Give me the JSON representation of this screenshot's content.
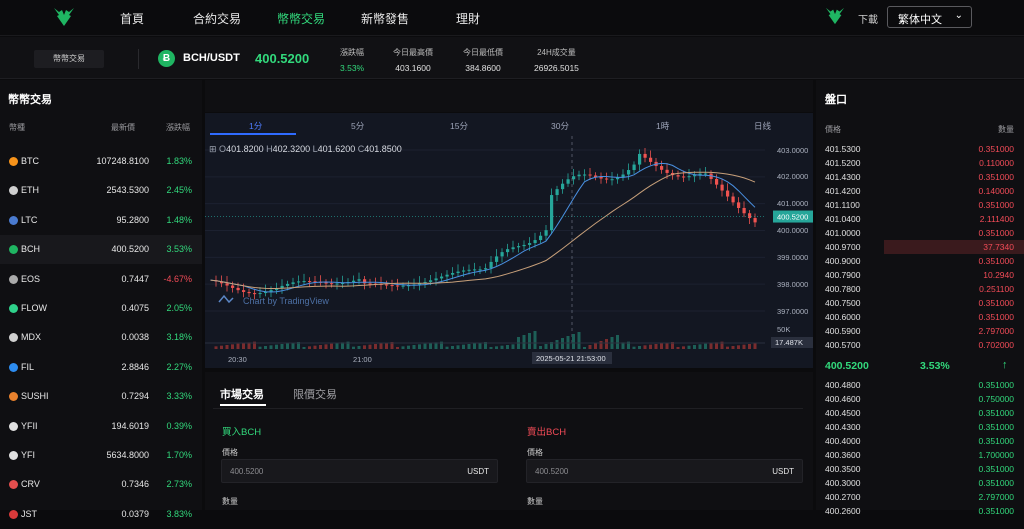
{
  "nav": {
    "items": [
      "首頁",
      "合約交易",
      "幣幣交易",
      "新幣發售",
      "理財"
    ],
    "download": "下載",
    "language": "繁体中文"
  },
  "ticker": {
    "button": "幣幣交易",
    "pair": "BCH/USDT",
    "price": "400.5200",
    "stats": [
      {
        "label": "漲跌幅",
        "value": "3.53%"
      },
      {
        "label": "今日最高價",
        "value": "403.1600"
      },
      {
        "label": "今日最低價",
        "value": "384.8600"
      },
      {
        "label": "24H成交量",
        "value": "26926.5015"
      }
    ]
  },
  "market": {
    "title": "幣幣交易",
    "headers": [
      "幣種",
      "最新價",
      "漲跌幅"
    ],
    "rows": [
      {
        "sym": "BTC",
        "price": "107248.8100",
        "change": "1.83%",
        "dir": "up",
        "color": "#f7931a"
      },
      {
        "sym": "ETH",
        "price": "2543.5300",
        "change": "2.45%",
        "dir": "up",
        "color": "#cfcfcf"
      },
      {
        "sym": "LTC",
        "price": "95.2800",
        "change": "1.48%",
        "dir": "up",
        "color": "#4a7bd0"
      },
      {
        "sym": "BCH",
        "price": "400.5200",
        "change": "3.53%",
        "dir": "up",
        "color": "#1fb562"
      },
      {
        "sym": "EOS",
        "price": "0.7447",
        "change": "-4.67%",
        "dir": "down",
        "color": "#aaaaaa"
      },
      {
        "sym": "FLOW",
        "price": "0.4075",
        "change": "2.05%",
        "dir": "up",
        "color": "#2fd18b"
      },
      {
        "sym": "MDX",
        "price": "0.0038",
        "change": "3.18%",
        "dir": "up",
        "color": "#d0d0d0"
      },
      {
        "sym": "FIL",
        "price": "2.8846",
        "change": "2.27%",
        "dir": "up",
        "color": "#2d8cf0"
      },
      {
        "sym": "SUSHI",
        "price": "0.7294",
        "change": "3.33%",
        "dir": "up",
        "color": "#e8812d"
      },
      {
        "sym": "YFII",
        "price": "194.6019",
        "change": "0.39%",
        "dir": "up",
        "color": "#e0e0e0"
      },
      {
        "sym": "YFI",
        "price": "5634.8000",
        "change": "1.70%",
        "dir": "up",
        "color": "#e0e0e0"
      },
      {
        "sym": "CRV",
        "price": "0.7346",
        "change": "2.73%",
        "dir": "up",
        "color": "#e34e4e"
      },
      {
        "sym": "JST",
        "price": "0.0379",
        "change": "3.83%",
        "dir": "up",
        "color": "#d83a3a"
      }
    ]
  },
  "chart": {
    "tabs": [
      "1分",
      "5分",
      "15分",
      "30分",
      "1時",
      "日线"
    ],
    "ohlc": {
      "o": "401.8200",
      "h": "402.3200",
      "l": "401.6200",
      "c": "401.8500"
    },
    "yticks": [
      "403.0000",
      "402.0000",
      "401.0000",
      "400.0000",
      "399.0000",
      "398.0000",
      "397.0000"
    ],
    "current_price": "400.5200",
    "vol_label": "50K",
    "vol_value": "17.487K",
    "xticks": [
      "20:30",
      "21:00"
    ],
    "crosshair_time": "2025-05-21 21:53:00",
    "watermark": "Chart by TradingView"
  },
  "trade": {
    "tabs": [
      "市場交易",
      "限價交易"
    ],
    "buy_title": "買入BCH",
    "sell_title": "賣出BCH",
    "price_label": "價格",
    "price_value": "400.5200",
    "unit": "USDT",
    "qty_label": "數量"
  },
  "orderbook": {
    "title": "盤口",
    "headers": [
      "價格",
      "數量"
    ],
    "asks": [
      [
        "401.5300",
        "0.351000"
      ],
      [
        "401.5200",
        "0.110000"
      ],
      [
        "401.4300",
        "0.351000"
      ],
      [
        "401.4200",
        "0.140000"
      ],
      [
        "401.1100",
        "0.351000"
      ],
      [
        "401.0400",
        "2.111400"
      ],
      [
        "401.0000",
        "0.351000"
      ],
      [
        "400.9700",
        "37.7340"
      ],
      [
        "400.9000",
        "0.351000"
      ],
      [
        "400.7900",
        "10.2940"
      ],
      [
        "400.7800",
        "0.251100"
      ],
      [
        "400.7500",
        "0.351000"
      ],
      [
        "400.6000",
        "0.351000"
      ],
      [
        "400.5900",
        "2.797000"
      ],
      [
        "400.5700",
        "0.702000"
      ]
    ],
    "mid_price": "400.5200",
    "mid_change": "3.53%",
    "mid_arrow": "↑",
    "bids": [
      [
        "400.4800",
        "0.351000"
      ],
      [
        "400.4600",
        "0.750000"
      ],
      [
        "400.4500",
        "0.351000"
      ],
      [
        "400.4300",
        "0.351000"
      ],
      [
        "400.4000",
        "0.351000"
      ],
      [
        "400.3600",
        "1.700000"
      ],
      [
        "400.3500",
        "0.351000"
      ],
      [
        "400.3000",
        "0.351000"
      ],
      [
        "400.2700",
        "2.797000"
      ],
      [
        "400.2600",
        "0.351000"
      ]
    ]
  }
}
